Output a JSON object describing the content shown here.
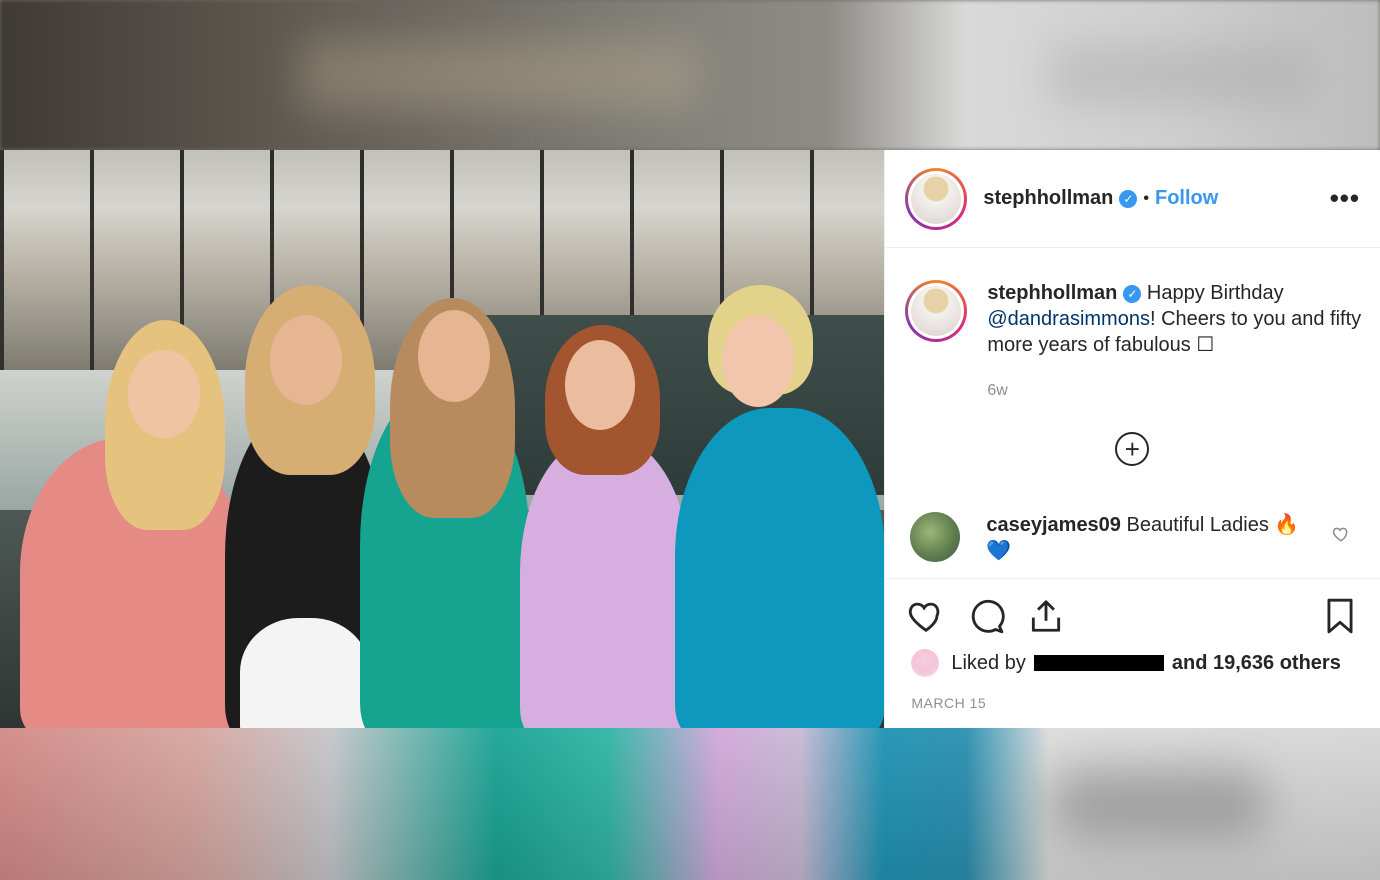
{
  "post": {
    "username": "stephhollman",
    "separator": "•",
    "follow_label": "Follow",
    "more_label": "•••",
    "caption": {
      "username": "stephhollman",
      "text_before": " Happy Birthday ",
      "mention": "@dandrasimmons",
      "text_after": "! Cheers to you and fifty more years of fabulous ☐"
    },
    "time_ago": "6w",
    "load_more_label": "+",
    "comments": [
      {
        "username": "caseyjames09",
        "text": " Beautiful Ladies 🔥💙"
      }
    ],
    "likes": {
      "prefix": "Liked by ",
      "suffix": " and 19,636 others"
    },
    "date": "MARCH 15"
  },
  "icons": {
    "verified": "verified-badge-icon",
    "like": "heart-icon",
    "comment": "comment-icon",
    "share": "share-icon",
    "save": "bookmark-icon"
  },
  "colors": {
    "accent": "#3897f0",
    "text": "#262626",
    "muted": "#8e8e8e",
    "border": "#efefef"
  }
}
